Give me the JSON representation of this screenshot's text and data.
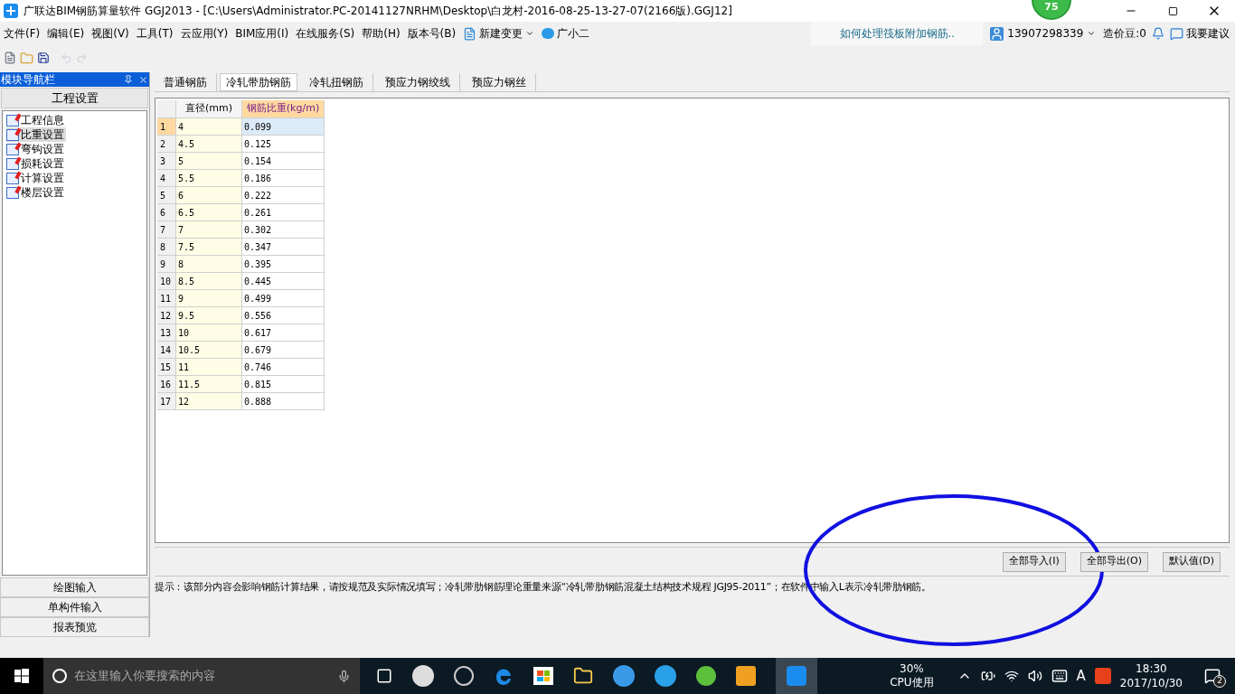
{
  "window": {
    "title": "广联达BIM钢筋算量软件 GGJ2013 - [C:\\Users\\Administrator.PC-20141127NRHM\\Desktop\\白龙村-2016-08-25-13-27-07(2166版).GGJ12]",
    "badge": "75"
  },
  "menu": [
    "文件(F)",
    "编辑(E)",
    "视图(V)",
    "工具(T)",
    "云应用(Y)",
    "BIM应用(I)",
    "在线服务(S)",
    "帮助(H)",
    "版本号(B)"
  ],
  "menu_extra": {
    "new_change": "新建变更",
    "assistant": "广小二",
    "tip_link": "如何处理筏板附加钢筋..",
    "account": "13907298339",
    "beans": "造价豆:0",
    "suggest": "我要建议"
  },
  "nav": {
    "title": "模块导航栏",
    "section": "工程设置",
    "items": [
      {
        "label": "工程信息",
        "selected": false
      },
      {
        "label": "比重设置",
        "selected": true
      },
      {
        "label": "弯钩设置",
        "selected": false
      },
      {
        "label": "损耗设置",
        "selected": false
      },
      {
        "label": "计算设置",
        "selected": false
      },
      {
        "label": "楼层设置",
        "selected": false
      }
    ],
    "bottom": [
      "绘图输入",
      "单构件输入",
      "报表预览"
    ]
  },
  "tabs": [
    {
      "label": "普通钢筋",
      "selected": false
    },
    {
      "label": "冷轧带肋钢筋",
      "selected": true
    },
    {
      "label": "冷轧扭钢筋",
      "selected": false
    },
    {
      "label": "预应力钢绞线",
      "selected": false
    },
    {
      "label": "预应力钢丝",
      "selected": false
    }
  ],
  "table": {
    "columns": [
      "直径(mm)",
      "钢筋比重(kg/m)"
    ],
    "rows": [
      {
        "index": "1",
        "diameter": "4",
        "weight": "0.099",
        "selected": true
      },
      {
        "index": "2",
        "diameter": "4.5",
        "weight": "0.125",
        "selected": false
      },
      {
        "index": "3",
        "diameter": "5",
        "weight": "0.154",
        "selected": false
      },
      {
        "index": "4",
        "diameter": "5.5",
        "weight": "0.186",
        "selected": false
      },
      {
        "index": "5",
        "diameter": "6",
        "weight": "0.222",
        "selected": false
      },
      {
        "index": "6",
        "diameter": "6.5",
        "weight": "0.261",
        "selected": false
      },
      {
        "index": "7",
        "diameter": "7",
        "weight": "0.302",
        "selected": false
      },
      {
        "index": "8",
        "diameter": "7.5",
        "weight": "0.347",
        "selected": false
      },
      {
        "index": "9",
        "diameter": "8",
        "weight": "0.395",
        "selected": false
      },
      {
        "index": "10",
        "diameter": "8.5",
        "weight": "0.445",
        "selected": false
      },
      {
        "index": "11",
        "diameter": "9",
        "weight": "0.499",
        "selected": false
      },
      {
        "index": "12",
        "diameter": "9.5",
        "weight": "0.556",
        "selected": false
      },
      {
        "index": "13",
        "diameter": "10",
        "weight": "0.617",
        "selected": false
      },
      {
        "index": "14",
        "diameter": "10.5",
        "weight": "0.679",
        "selected": false
      },
      {
        "index": "15",
        "diameter": "11",
        "weight": "0.746",
        "selected": false
      },
      {
        "index": "16",
        "diameter": "11.5",
        "weight": "0.815",
        "selected": false
      },
      {
        "index": "17",
        "diameter": "12",
        "weight": "0.888",
        "selected": false
      }
    ]
  },
  "buttons": [
    "全部导入(I)",
    "全部导出(O)",
    "默认值(D)"
  ],
  "hint": "提示：该部分内容会影响钢筋计算结果，请按规范及实际情况填写；冷轧带肋钢筋理论重量来源“冷轧带肋钢筋混凝土结构技术规程 JGJ95-2011”；在软件中输入L表示冷轧带肋钢筋。",
  "taskbar": {
    "search_placeholder": "在这里输入你要搜索的内容",
    "cpu": "30%",
    "cpu_label": "CPU使用",
    "ime": "A",
    "time": "18:30",
    "date": "2017/10/30",
    "notifications": "2"
  }
}
